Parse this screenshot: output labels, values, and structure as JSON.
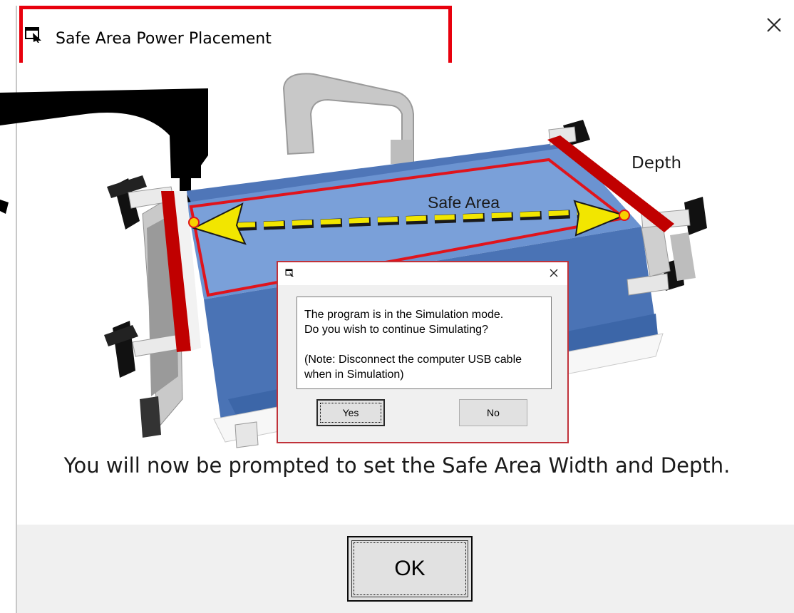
{
  "window": {
    "title": "Safe Area Power Placement",
    "close_glyph": "✕",
    "icon": "window-app-icon"
  },
  "illustration": {
    "safe_area_label": "Safe Area",
    "depth_label": "Depth",
    "colors": {
      "fabric": "#5b86c7",
      "frame": "#d9d9d9",
      "highlight_red": "#c00000",
      "arrow_yellow": "#f2e600"
    }
  },
  "prompt": "You will now be prompted to set the Safe Area Width and Depth.",
  "ok_label": "OK",
  "simulation_dialog": {
    "close_glyph": "✕",
    "line1": "The program is in the Simulation mode.",
    "line2": "Do you wish to continue Simulating?",
    "line3": "(Note: Disconnect the computer USB cable",
    "line4": "when in Simulation)",
    "yes_label": "Yes",
    "no_label": "No"
  }
}
